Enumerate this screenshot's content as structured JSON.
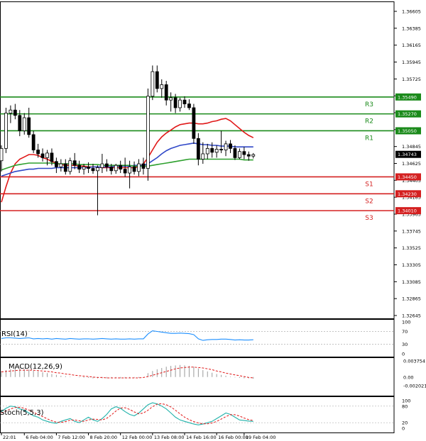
{
  "chart_data": {
    "type": "candlestick",
    "main": {
      "ylim": [
        1.32645,
        1.36605
      ],
      "y_ticks": [
        "1.36605",
        "1.36385",
        "1.36165",
        "1.35945",
        "1.35725",
        "1.35505",
        "1.35285",
        "1.35065",
        "1.34845",
        "1.34625",
        "1.34405",
        "1.34185",
        "1.33965",
        "1.33745",
        "1.33525",
        "1.33305",
        "1.33085",
        "1.32865",
        "1.32645"
      ],
      "current_price": "1.34743",
      "grid": false,
      "levels": [
        {
          "name": "R3",
          "value": 1.3549,
          "value_label": "1.35490",
          "kind": "resistance"
        },
        {
          "name": "R2",
          "value": 1.3527,
          "value_label": "1.35270",
          "kind": "resistance"
        },
        {
          "name": "R1",
          "value": 1.3505,
          "value_label": "1.35050",
          "kind": "resistance"
        },
        {
          "name": "S1",
          "value": 1.3445,
          "value_label": "1.34450",
          "kind": "support"
        },
        {
          "name": "S2",
          "value": 1.3423,
          "value_label": "1.34230",
          "kind": "support"
        },
        {
          "name": "S3",
          "value": 1.3401,
          "value_label": "1.34010",
          "kind": "support"
        }
      ],
      "candles": [
        {
          "o": 1.3466,
          "h": 1.3486,
          "l": 1.3452,
          "c": 1.3482
        },
        {
          "o": 1.3482,
          "h": 1.3535,
          "l": 1.3476,
          "c": 1.3528
        },
        {
          "o": 1.3528,
          "h": 1.3538,
          "l": 1.3515,
          "c": 1.3532
        },
        {
          "o": 1.3532,
          "h": 1.354,
          "l": 1.352,
          "c": 1.3525
        },
        {
          "o": 1.3525,
          "h": 1.3532,
          "l": 1.3498,
          "c": 1.3505
        },
        {
          "o": 1.3505,
          "h": 1.3528,
          "l": 1.35,
          "c": 1.3522
        },
        {
          "o": 1.3522,
          "h": 1.3535,
          "l": 1.3496,
          "c": 1.35
        },
        {
          "o": 1.35,
          "h": 1.3505,
          "l": 1.3476,
          "c": 1.348
        },
        {
          "o": 1.348,
          "h": 1.3488,
          "l": 1.347,
          "c": 1.3475
        },
        {
          "o": 1.3475,
          "h": 1.3482,
          "l": 1.3465,
          "c": 1.347
        },
        {
          "o": 1.347,
          "h": 1.348,
          "l": 1.346,
          "c": 1.3476
        },
        {
          "o": 1.3476,
          "h": 1.3482,
          "l": 1.346,
          "c": 1.3465
        },
        {
          "o": 1.3465,
          "h": 1.347,
          "l": 1.345,
          "c": 1.3458
        },
        {
          "o": 1.3458,
          "h": 1.3468,
          "l": 1.3452,
          "c": 1.3462
        },
        {
          "o": 1.3462,
          "h": 1.3468,
          "l": 1.3448,
          "c": 1.3452
        },
        {
          "o": 1.3452,
          "h": 1.347,
          "l": 1.3448,
          "c": 1.3466
        },
        {
          "o": 1.3466,
          "h": 1.3476,
          "l": 1.3455,
          "c": 1.346
        },
        {
          "o": 1.346,
          "h": 1.3466,
          "l": 1.345,
          "c": 1.3455
        },
        {
          "o": 1.3455,
          "h": 1.3462,
          "l": 1.3448,
          "c": 1.3458
        },
        {
          "o": 1.3458,
          "h": 1.3464,
          "l": 1.345,
          "c": 1.3456
        },
        {
          "o": 1.3456,
          "h": 1.3462,
          "l": 1.3449,
          "c": 1.3453
        },
        {
          "o": 1.3453,
          "h": 1.346,
          "l": 1.3395,
          "c": 1.3457
        },
        {
          "o": 1.3457,
          "h": 1.3475,
          "l": 1.345,
          "c": 1.3462
        },
        {
          "o": 1.3462,
          "h": 1.3468,
          "l": 1.3452,
          "c": 1.3458
        },
        {
          "o": 1.3458,
          "h": 1.3462,
          "l": 1.3448,
          "c": 1.3453
        },
        {
          "o": 1.3453,
          "h": 1.3462,
          "l": 1.3449,
          "c": 1.346
        },
        {
          "o": 1.346,
          "h": 1.3466,
          "l": 1.345,
          "c": 1.3455
        },
        {
          "o": 1.3455,
          "h": 1.347,
          "l": 1.3445,
          "c": 1.345
        },
        {
          "o": 1.345,
          "h": 1.3466,
          "l": 1.343,
          "c": 1.3458
        },
        {
          "o": 1.3458,
          "h": 1.3465,
          "l": 1.3448,
          "c": 1.3452
        },
        {
          "o": 1.3452,
          "h": 1.3468,
          "l": 1.3446,
          "c": 1.3462
        },
        {
          "o": 1.3462,
          "h": 1.347,
          "l": 1.3448,
          "c": 1.3456
        },
        {
          "o": 1.3456,
          "h": 1.356,
          "l": 1.344,
          "c": 1.355
        },
        {
          "o": 1.355,
          "h": 1.359,
          "l": 1.3545,
          "c": 1.3582
        },
        {
          "o": 1.3582,
          "h": 1.359,
          "l": 1.3555,
          "c": 1.356
        },
        {
          "o": 1.356,
          "h": 1.3572,
          "l": 1.3548,
          "c": 1.3565
        },
        {
          "o": 1.3565,
          "h": 1.357,
          "l": 1.3538,
          "c": 1.3545
        },
        {
          "o": 1.3545,
          "h": 1.3555,
          "l": 1.353,
          "c": 1.3548
        },
        {
          "o": 1.3548,
          "h": 1.3553,
          "l": 1.3528,
          "c": 1.3535
        },
        {
          "o": 1.3535,
          "h": 1.3548,
          "l": 1.353,
          "c": 1.3545
        },
        {
          "o": 1.3545,
          "h": 1.355,
          "l": 1.3535,
          "c": 1.354
        },
        {
          "o": 1.354,
          "h": 1.3546,
          "l": 1.3532,
          "c": 1.3535
        },
        {
          "o": 1.3535,
          "h": 1.354,
          "l": 1.3488,
          "c": 1.3495
        },
        {
          "o": 1.3495,
          "h": 1.3502,
          "l": 1.346,
          "c": 1.3468
        },
        {
          "o": 1.3468,
          "h": 1.349,
          "l": 1.3462,
          "c": 1.3475
        },
        {
          "o": 1.3475,
          "h": 1.3488,
          "l": 1.3468,
          "c": 1.3482
        },
        {
          "o": 1.3482,
          "h": 1.349,
          "l": 1.347,
          "c": 1.3477
        },
        {
          "o": 1.3477,
          "h": 1.3486,
          "l": 1.347,
          "c": 1.3481
        },
        {
          "o": 1.3481,
          "h": 1.3505,
          "l": 1.3476,
          "c": 1.348
        },
        {
          "o": 1.348,
          "h": 1.3492,
          "l": 1.3472,
          "c": 1.3488
        },
        {
          "o": 1.3488,
          "h": 1.3493,
          "l": 1.3476,
          "c": 1.3482
        },
        {
          "o": 1.3482,
          "h": 1.3486,
          "l": 1.3467,
          "c": 1.347
        },
        {
          "o": 1.347,
          "h": 1.3482,
          "l": 1.3468,
          "c": 1.3478
        },
        {
          "o": 1.3478,
          "h": 1.3484,
          "l": 1.3468,
          "c": 1.3474
        },
        {
          "o": 1.3474,
          "h": 1.3478,
          "l": 1.3466,
          "c": 1.3472
        },
        {
          "o": 1.3472,
          "h": 1.3476,
          "l": 1.3469,
          "c": 1.3474
        }
      ],
      "moving_averages": [
        {
          "color": "#e01818",
          "values": [
            1.3412,
            1.3432,
            1.345,
            1.3462,
            1.3468,
            1.3471,
            1.3474,
            1.3474,
            1.3473,
            1.347,
            1.3468,
            1.3465,
            1.3463,
            1.3461,
            1.346,
            1.346,
            1.346,
            1.3459,
            1.3459,
            1.3458,
            1.3458,
            1.3458,
            1.3457,
            1.3457,
            1.3457,
            1.3457,
            1.3457,
            1.3457,
            1.3457,
            1.3457,
            1.3458,
            1.3462,
            1.347,
            1.348,
            1.349,
            1.3497,
            1.3502,
            1.3506,
            1.351,
            1.3513,
            1.3514,
            1.3515,
            1.3515,
            1.3514,
            1.3514,
            1.3515,
            1.3517,
            1.3518,
            1.352,
            1.3521,
            1.3518,
            1.3513,
            1.3508,
            1.3503,
            1.3499,
            1.3496
          ]
        },
        {
          "color": "#3048c8",
          "values": [
            1.3446,
            1.3448,
            1.345,
            1.3452,
            1.3453,
            1.3454,
            1.3455,
            1.3455,
            1.3456,
            1.3456,
            1.3456,
            1.3456,
            1.3457,
            1.3457,
            1.3457,
            1.3457,
            1.3457,
            1.3457,
            1.3457,
            1.3457,
            1.3458,
            1.3458,
            1.3458,
            1.3458,
            1.3458,
            1.3459,
            1.3459,
            1.3459,
            1.3459,
            1.346,
            1.346,
            1.346,
            1.3462,
            1.3466,
            1.347,
            1.3475,
            1.3479,
            1.3482,
            1.3484,
            1.3486,
            1.3487,
            1.3488,
            1.3489,
            1.3488,
            1.3487,
            1.3487,
            1.3486,
            1.3486,
            1.3485,
            1.3485,
            1.3485,
            1.3484,
            1.3484,
            1.3484,
            1.3484,
            1.3484
          ]
        },
        {
          "color": "#2ea02e",
          "values": [
            1.3454,
            1.3456,
            1.3458,
            1.346,
            1.3461,
            1.3462,
            1.3463,
            1.3463,
            1.3463,
            1.3463,
            1.3463,
            1.3463,
            1.3462,
            1.3462,
            1.3462,
            1.3462,
            1.3462,
            1.3461,
            1.3461,
            1.3461,
            1.3461,
            1.3461,
            1.346,
            1.346,
            1.346,
            1.346,
            1.346,
            1.346,
            1.346,
            1.3459,
            1.3459,
            1.3459,
            1.3459,
            1.346,
            1.3461,
            1.3462,
            1.3463,
            1.3464,
            1.3465,
            1.3466,
            1.3467,
            1.3468,
            1.3468,
            1.3468,
            1.3468,
            1.3468,
            1.3468,
            1.3468,
            1.3468,
            1.3468,
            1.3468,
            1.3468,
            1.3468,
            1.3467,
            1.3467,
            1.3467
          ]
        }
      ]
    },
    "x_ticks": [
      {
        "label": "22:01",
        "index": 0
      },
      {
        "label": "6 Feb 04:00",
        "index": 5
      },
      {
        "label": "7 Feb 12:00",
        "index": 12
      },
      {
        "label": "8 Feb 20:00",
        "index": 19
      },
      {
        "label": "12 Feb 00:00",
        "index": 26
      },
      {
        "label": "13 Feb 08:00",
        "index": 33
      },
      {
        "label": "14 Feb 16:00",
        "index": 40
      },
      {
        "label": "16 Feb 00:00",
        "index": 47
      },
      {
        "label": "19 Feb 04:00",
        "index": 53
      }
    ],
    "rsi": {
      "label": "RSI(14)",
      "ylim": [
        0,
        100
      ],
      "y_ticks": [
        "100",
        "70",
        "30",
        "0"
      ],
      "values": [
        48,
        50,
        50,
        49,
        48,
        49,
        50,
        47,
        48,
        47,
        48,
        46,
        48,
        47,
        46,
        48,
        47,
        46,
        47,
        47,
        46,
        47,
        48,
        47,
        46,
        47,
        46,
        46,
        47,
        46,
        47,
        47,
        62,
        72,
        70,
        68,
        66,
        64,
        64,
        65,
        64,
        63,
        60,
        47,
        42,
        44,
        45,
        45,
        46,
        46,
        45,
        43,
        44,
        43,
        43,
        44
      ]
    },
    "macd": {
      "label": "MACD(12,26,9)",
      "ylim": [
        -0.002021,
        0.003754
      ],
      "y_ticks": [
        "0.003754",
        "0.00",
        "-0.002021"
      ],
      "histogram": [
        0.0014,
        0.0016,
        0.0018,
        0.0019,
        0.0019,
        0.0018,
        0.0017,
        0.0015,
        0.0013,
        0.0011,
        0.0009,
        0.0007,
        0.0005,
        0.0003,
        0.0002,
        0.0001,
        0.0,
        -0.0001,
        -0.0002,
        -0.0002,
        -0.0003,
        -0.0003,
        -0.0003,
        -0.0003,
        -0.0003,
        -0.0003,
        -0.0003,
        -0.0003,
        -0.0002,
        -0.0002,
        -0.0002,
        0.0,
        0.0009,
        0.0014,
        0.0018,
        0.0021,
        0.0024,
        0.0026,
        0.0027,
        0.0028,
        0.0027,
        0.0026,
        0.0024,
        0.002,
        0.0016,
        0.0013,
        0.001,
        0.0007,
        0.0005,
        0.0003,
        0.0001,
        -0.0001,
        -0.0002,
        -0.0003,
        -0.0003,
        -0.0004
      ],
      "signal": [
        0.0012,
        0.0013,
        0.0014,
        0.0015,
        0.0016,
        0.0016,
        0.0016,
        0.0016,
        0.0015,
        0.0014,
        0.0013,
        0.0012,
        0.001,
        0.0009,
        0.0007,
        0.0006,
        0.0004,
        0.0003,
        0.0002,
        0.0001,
        0.0,
        -0.0001,
        -0.0001,
        -0.0002,
        -0.0002,
        -0.0002,
        -0.0002,
        -0.0002,
        -0.0002,
        -0.0002,
        -0.0002,
        -0.0001,
        0.0001,
        0.0004,
        0.0007,
        0.001,
        0.0013,
        0.0016,
        0.0019,
        0.0021,
        0.0022,
        0.0023,
        0.0023,
        0.0022,
        0.0021,
        0.0019,
        0.0017,
        0.0014,
        0.0012,
        0.0009,
        0.0007,
        0.0005,
        0.0003,
        0.0001,
        -0.0001,
        -0.0002
      ]
    },
    "stoch": {
      "label": "Stoch(5,5,3)",
      "ylim": [
        0,
        100
      ],
      "y_ticks": [
        "100",
        "80",
        "20",
        "0"
      ],
      "main": [
        60,
        72,
        80,
        78,
        70,
        65,
        55,
        45,
        40,
        30,
        25,
        20,
        18,
        25,
        30,
        35,
        25,
        20,
        30,
        40,
        30,
        25,
        35,
        50,
        70,
        78,
        72,
        60,
        50,
        45,
        55,
        70,
        85,
        92,
        88,
        80,
        70,
        55,
        40,
        30,
        25,
        20,
        15,
        12,
        15,
        20,
        25,
        35,
        45,
        55,
        50,
        40,
        30,
        28,
        26,
        25
      ],
      "signal": [
        55,
        62,
        70,
        75,
        76,
        72,
        66,
        58,
        50,
        42,
        34,
        27,
        22,
        21,
        24,
        29,
        30,
        27,
        25,
        30,
        33,
        32,
        30,
        36,
        48,
        62,
        73,
        74,
        68,
        59,
        52,
        55,
        65,
        78,
        87,
        89,
        85,
        77,
        65,
        52,
        40,
        31,
        24,
        19,
        16,
        16,
        19,
        25,
        33,
        42,
        49,
        49,
        44,
        37,
        31,
        28
      ]
    }
  }
}
